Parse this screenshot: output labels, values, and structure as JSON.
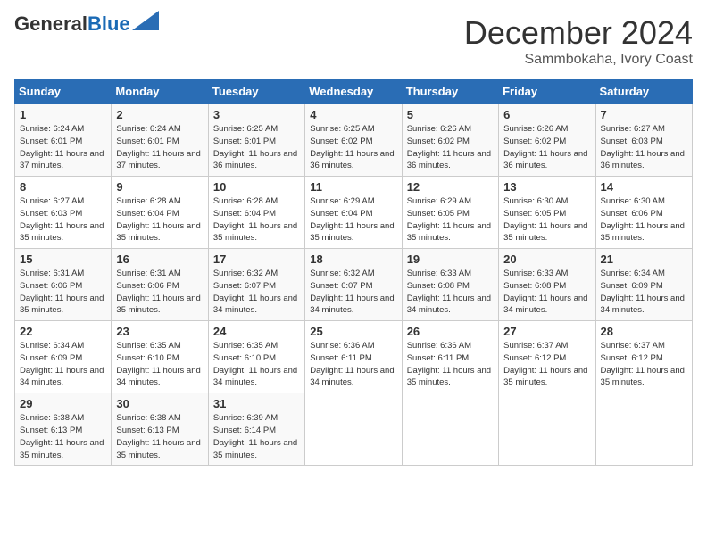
{
  "header": {
    "logo_general": "General",
    "logo_blue": "Blue",
    "month": "December 2024",
    "location": "Sammbokaha, Ivory Coast"
  },
  "weekdays": [
    "Sunday",
    "Monday",
    "Tuesday",
    "Wednesday",
    "Thursday",
    "Friday",
    "Saturday"
  ],
  "weeks": [
    [
      {
        "day": "1",
        "sunrise": "6:24 AM",
        "sunset": "6:01 PM",
        "daylight": "11 hours and 37 minutes."
      },
      {
        "day": "2",
        "sunrise": "6:24 AM",
        "sunset": "6:01 PM",
        "daylight": "11 hours and 37 minutes."
      },
      {
        "day": "3",
        "sunrise": "6:25 AM",
        "sunset": "6:01 PM",
        "daylight": "11 hours and 36 minutes."
      },
      {
        "day": "4",
        "sunrise": "6:25 AM",
        "sunset": "6:02 PM",
        "daylight": "11 hours and 36 minutes."
      },
      {
        "day": "5",
        "sunrise": "6:26 AM",
        "sunset": "6:02 PM",
        "daylight": "11 hours and 36 minutes."
      },
      {
        "day": "6",
        "sunrise": "6:26 AM",
        "sunset": "6:02 PM",
        "daylight": "11 hours and 36 minutes."
      },
      {
        "day": "7",
        "sunrise": "6:27 AM",
        "sunset": "6:03 PM",
        "daylight": "11 hours and 36 minutes."
      }
    ],
    [
      {
        "day": "8",
        "sunrise": "6:27 AM",
        "sunset": "6:03 PM",
        "daylight": "11 hours and 35 minutes."
      },
      {
        "day": "9",
        "sunrise": "6:28 AM",
        "sunset": "6:04 PM",
        "daylight": "11 hours and 35 minutes."
      },
      {
        "day": "10",
        "sunrise": "6:28 AM",
        "sunset": "6:04 PM",
        "daylight": "11 hours and 35 minutes."
      },
      {
        "day": "11",
        "sunrise": "6:29 AM",
        "sunset": "6:04 PM",
        "daylight": "11 hours and 35 minutes."
      },
      {
        "day": "12",
        "sunrise": "6:29 AM",
        "sunset": "6:05 PM",
        "daylight": "11 hours and 35 minutes."
      },
      {
        "day": "13",
        "sunrise": "6:30 AM",
        "sunset": "6:05 PM",
        "daylight": "11 hours and 35 minutes."
      },
      {
        "day": "14",
        "sunrise": "6:30 AM",
        "sunset": "6:06 PM",
        "daylight": "11 hours and 35 minutes."
      }
    ],
    [
      {
        "day": "15",
        "sunrise": "6:31 AM",
        "sunset": "6:06 PM",
        "daylight": "11 hours and 35 minutes."
      },
      {
        "day": "16",
        "sunrise": "6:31 AM",
        "sunset": "6:06 PM",
        "daylight": "11 hours and 35 minutes."
      },
      {
        "day": "17",
        "sunrise": "6:32 AM",
        "sunset": "6:07 PM",
        "daylight": "11 hours and 34 minutes."
      },
      {
        "day": "18",
        "sunrise": "6:32 AM",
        "sunset": "6:07 PM",
        "daylight": "11 hours and 34 minutes."
      },
      {
        "day": "19",
        "sunrise": "6:33 AM",
        "sunset": "6:08 PM",
        "daylight": "11 hours and 34 minutes."
      },
      {
        "day": "20",
        "sunrise": "6:33 AM",
        "sunset": "6:08 PM",
        "daylight": "11 hours and 34 minutes."
      },
      {
        "day": "21",
        "sunrise": "6:34 AM",
        "sunset": "6:09 PM",
        "daylight": "11 hours and 34 minutes."
      }
    ],
    [
      {
        "day": "22",
        "sunrise": "6:34 AM",
        "sunset": "6:09 PM",
        "daylight": "11 hours and 34 minutes."
      },
      {
        "day": "23",
        "sunrise": "6:35 AM",
        "sunset": "6:10 PM",
        "daylight": "11 hours and 34 minutes."
      },
      {
        "day": "24",
        "sunrise": "6:35 AM",
        "sunset": "6:10 PM",
        "daylight": "11 hours and 34 minutes."
      },
      {
        "day": "25",
        "sunrise": "6:36 AM",
        "sunset": "6:11 PM",
        "daylight": "11 hours and 34 minutes."
      },
      {
        "day": "26",
        "sunrise": "6:36 AM",
        "sunset": "6:11 PM",
        "daylight": "11 hours and 35 minutes."
      },
      {
        "day": "27",
        "sunrise": "6:37 AM",
        "sunset": "6:12 PM",
        "daylight": "11 hours and 35 minutes."
      },
      {
        "day": "28",
        "sunrise": "6:37 AM",
        "sunset": "6:12 PM",
        "daylight": "11 hours and 35 minutes."
      }
    ],
    [
      {
        "day": "29",
        "sunrise": "6:38 AM",
        "sunset": "6:13 PM",
        "daylight": "11 hours and 35 minutes."
      },
      {
        "day": "30",
        "sunrise": "6:38 AM",
        "sunset": "6:13 PM",
        "daylight": "11 hours and 35 minutes."
      },
      {
        "day": "31",
        "sunrise": "6:39 AM",
        "sunset": "6:14 PM",
        "daylight": "11 hours and 35 minutes."
      },
      null,
      null,
      null,
      null
    ]
  ]
}
